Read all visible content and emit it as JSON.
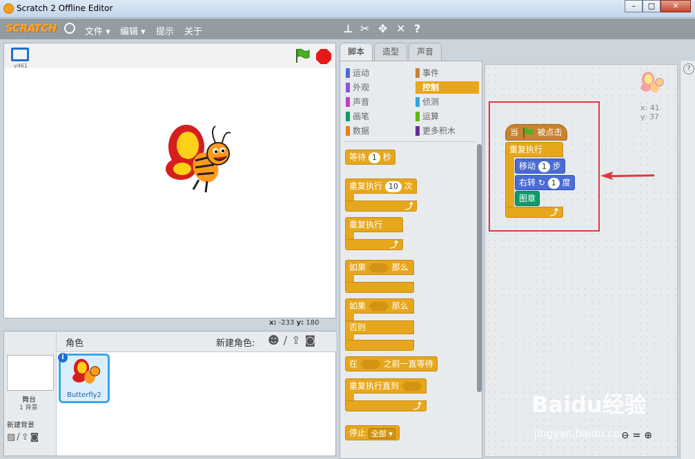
{
  "window": {
    "title": "Scratch 2 Offline Editor",
    "buttons": [
      "–",
      "□",
      "✕"
    ]
  },
  "menubar": {
    "logo": "SCRATCH",
    "items": [
      "文件 ▾",
      "编辑 ▾",
      "提示",
      "关于"
    ]
  },
  "stage": {
    "version": "v461",
    "x_label": "x:",
    "x_value": "-233",
    "y_label": "y:",
    "y_value": "180"
  },
  "sprites": {
    "header": "角色",
    "new_sprite": "新建角色:",
    "stage_label": "舞台",
    "stage_bg_count": "1 背景",
    "new_backdrop": "新建背景",
    "sprite_name": "Butterfly2",
    "info": "i"
  },
  "tabs": [
    "脚本",
    "造型",
    "声音"
  ],
  "categories": [
    {
      "label": "运动",
      "color": "#4a6cd4"
    },
    {
      "label": "外观",
      "color": "#8a55d7"
    },
    {
      "label": "声音",
      "color": "#bb42c3"
    },
    {
      "label": "画笔",
      "color": "#0e9a6c"
    },
    {
      "label": "数据",
      "color": "#ee7d16"
    },
    {
      "label": "事件",
      "color": "#c88330"
    },
    {
      "label": "控制",
      "color": "#e6a71d"
    },
    {
      "label": "侦测",
      "color": "#2ca5e2"
    },
    {
      "label": "运算",
      "color": "#5cb712"
    },
    {
      "label": "更多积木",
      "color": "#632d99"
    }
  ],
  "palette_blocks": {
    "wait": "等待",
    "wait_val": "1",
    "wait_unit": "秒",
    "repeat": "重复执行",
    "repeat_val": "10",
    "repeat_unit": "次",
    "forever": "重复执行",
    "if": "如果",
    "then": "那么",
    "if2": "如果",
    "then2": "那么",
    "else": "否则",
    "wait_until_pre": "在",
    "wait_until_post": "之前一直等待",
    "repeat_until": "重复执行直到",
    "stop": "停止",
    "stop_opt": "全部 ▾"
  },
  "script": {
    "hat_pre": "当",
    "hat_post": "被点击",
    "forever": "重复执行",
    "move": "移动",
    "move_val": "1",
    "move_unit": "步",
    "turn": "右转",
    "turn_val": "1",
    "turn_unit": "度",
    "stamp": "图章"
  },
  "sprite_info": {
    "x": "x: 41",
    "y": "y: 37"
  },
  "watermark": {
    "main": "Baidu经验",
    "sub": "jingyan.baidu.com"
  }
}
